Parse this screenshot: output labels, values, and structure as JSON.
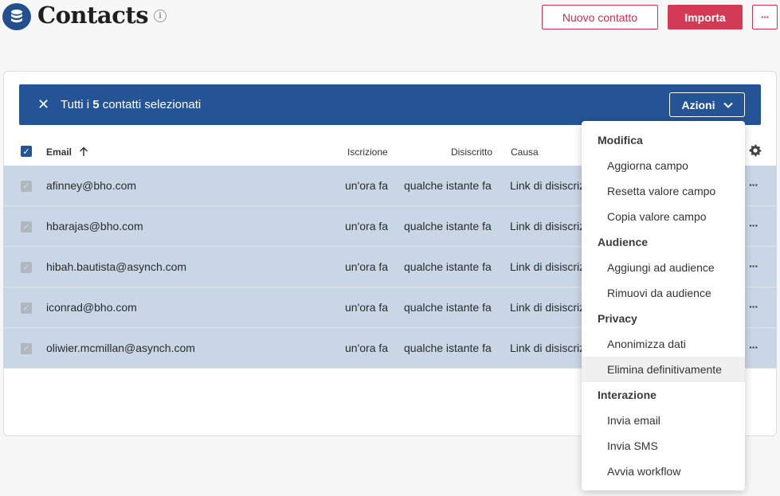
{
  "header": {
    "title": "Contacts",
    "info_icon": "i",
    "new_contact": "Nuovo contatto",
    "import": "Importa",
    "more": "···"
  },
  "banner": {
    "close": "✕",
    "prefix": "Tutti i ",
    "count": "5",
    "suffix": " contatti selezionati",
    "actions": "Azioni"
  },
  "table": {
    "columns": {
      "email": "Email",
      "iscrizione": "Iscrizione",
      "disiscritto": "Disiscritto",
      "causa": "Causa"
    },
    "rows": [
      {
        "email": "afinney@bho.com",
        "iscrizione": "un'ora fa",
        "disiscritto": "qualche istante fa",
        "causa": "Link di disiscrizione"
      },
      {
        "email": "hbarajas@bho.com",
        "iscrizione": "un'ora fa",
        "disiscritto": "qualche istante fa",
        "causa": "Link di disiscrizione"
      },
      {
        "email": "hibah.bautista@asynch.com",
        "iscrizione": "un'ora fa",
        "disiscritto": "qualche istante fa",
        "causa": "Link di disiscrizione"
      },
      {
        "email": "iconrad@bho.com",
        "iscrizione": "un'ora fa",
        "disiscritto": "qualche istante fa",
        "causa": "Link di disiscrizione"
      },
      {
        "email": "oliwier.mcmillan@asynch.com",
        "iscrizione": "un'ora fa",
        "disiscritto": "qualche istante fa",
        "causa": "Link di disiscrizione"
      }
    ]
  },
  "menu": {
    "groups": [
      {
        "label": "Modifica",
        "items": [
          "Aggiorna campo",
          "Resetta valore campo",
          "Copia valore campo"
        ]
      },
      {
        "label": "Audience",
        "items": [
          "Aggiungi ad audience",
          "Rimuovi da audience"
        ]
      },
      {
        "label": "Privacy",
        "items": [
          "Anonimizza dati",
          "Elimina definitivamente"
        ]
      },
      {
        "label": "Interazione",
        "items": [
          "Invia email",
          "Invia SMS",
          "Avvia workflow"
        ]
      }
    ]
  },
  "colors": {
    "brand_blue": "#245495",
    "accent_red": "#d33a56",
    "selected_row": "#c9d6e6"
  },
  "icons": {
    "logo": "database-icon",
    "info": "info-icon",
    "close": "close-icon",
    "chevron": "chevron-down-icon",
    "sort": "arrow-up-icon",
    "settings": "gear-icon",
    "row_more": "more-horizontal-icon"
  }
}
